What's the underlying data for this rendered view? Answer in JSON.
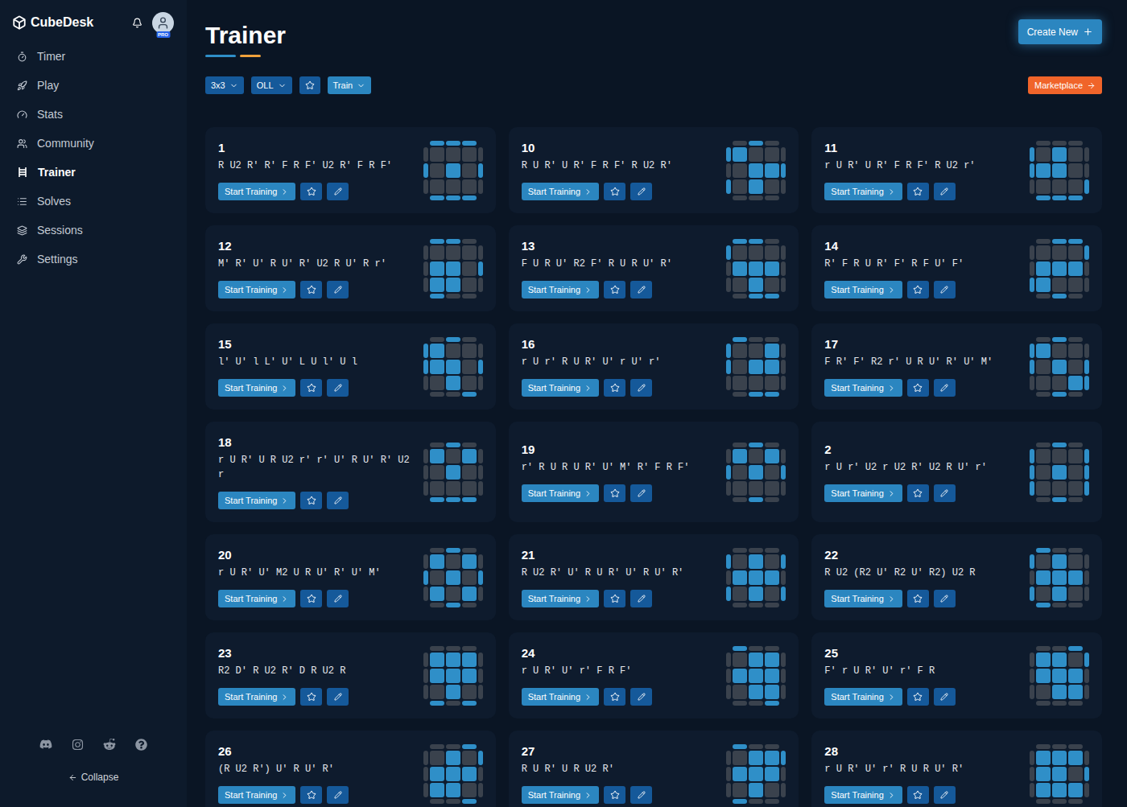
{
  "app": {
    "name": "CubeDesk",
    "badge": "PRO"
  },
  "sidebar": {
    "items": [
      {
        "label": "Timer",
        "selected": false
      },
      {
        "label": "Play",
        "selected": false
      },
      {
        "label": "Stats",
        "selected": false
      },
      {
        "label": "Community",
        "selected": false
      },
      {
        "label": "Trainer",
        "selected": true
      },
      {
        "label": "Solves",
        "selected": false
      },
      {
        "label": "Sessions",
        "selected": false
      },
      {
        "label": "Settings",
        "selected": false
      }
    ],
    "collapse": "Collapse"
  },
  "page": {
    "title": "Trainer"
  },
  "filters": [
    {
      "label": "3x3",
      "kind": "dropdown",
      "selected": false
    },
    {
      "label": "OLL",
      "kind": "dropdown",
      "selected": false
    },
    {
      "label": "",
      "kind": "favorite",
      "selected": false
    },
    {
      "label": "Train",
      "kind": "dropdown",
      "selected": true
    }
  ],
  "create_button": "Create New",
  "marketplace_button": "Marketplace",
  "card_action": "Start Training",
  "cards": [
    {
      "number": "1",
      "algorithm": "R U2 R' R' F R F' U2 R' F R F'",
      "favorite": false,
      "top": [
        false,
        false,
        false,
        false,
        true,
        false,
        false,
        false,
        false
      ],
      "sides": {
        "top": [
          true,
          true,
          true
        ],
        "right": [
          false,
          true,
          false
        ],
        "bottom": [
          true,
          true,
          true
        ],
        "left": [
          false,
          true,
          false
        ]
      }
    },
    {
      "number": "10",
      "algorithm": "R U R' U R' F R F' R U2 R'",
      "favorite": false,
      "top": [
        true,
        false,
        false,
        false,
        true,
        true,
        false,
        true,
        false
      ],
      "sides": {
        "top": [
          false,
          true,
          false
        ],
        "right": [
          false,
          true,
          false
        ],
        "bottom": [
          false,
          false,
          false
        ],
        "left": [
          true,
          false,
          true
        ]
      }
    },
    {
      "number": "11",
      "algorithm": "r U R' U R' F R F' R U2 r'",
      "favorite": false,
      "top": [
        false,
        true,
        false,
        true,
        true,
        false,
        false,
        false,
        false
      ],
      "sides": {
        "top": [
          false,
          false,
          false
        ],
        "right": [
          false,
          false,
          true
        ],
        "bottom": [
          true,
          true,
          true
        ],
        "left": [
          true,
          true,
          false
        ]
      }
    },
    {
      "number": "12",
      "algorithm": "M' R' U' R U' R' U2 R U' R r'",
      "favorite": false,
      "top": [
        false,
        false,
        false,
        true,
        true,
        false,
        true,
        true,
        false
      ],
      "sides": {
        "top": [
          true,
          true,
          false
        ],
        "right": [
          false,
          true,
          false
        ],
        "bottom": [
          true,
          false,
          false
        ],
        "left": [
          false,
          false,
          false
        ]
      }
    },
    {
      "number": "13",
      "algorithm": "F U R U' R2 F' R U R U' R'",
      "favorite": false,
      "top": [
        false,
        false,
        false,
        true,
        true,
        true,
        false,
        true,
        false
      ],
      "sides": {
        "top": [
          true,
          true,
          false
        ],
        "right": [
          false,
          false,
          false
        ],
        "bottom": [
          false,
          true,
          true
        ],
        "left": [
          true,
          false,
          false
        ]
      }
    },
    {
      "number": "14",
      "algorithm": "R' F R U R' F' R F U' F'",
      "favorite": false,
      "top": [
        false,
        false,
        false,
        true,
        true,
        true,
        true,
        false,
        false
      ],
      "sides": {
        "top": [
          false,
          true,
          true
        ],
        "right": [
          true,
          false,
          false
        ],
        "bottom": [
          false,
          true,
          false
        ],
        "left": [
          false,
          false,
          true
        ]
      }
    },
    {
      "number": "15",
      "algorithm": "l' U' l L' U' L U l' U l",
      "favorite": false,
      "top": [
        true,
        false,
        false,
        true,
        true,
        false,
        false,
        true,
        false
      ],
      "sides": {
        "top": [
          false,
          true,
          false
        ],
        "right": [
          false,
          true,
          false
        ],
        "bottom": [
          false,
          false,
          true
        ],
        "left": [
          true,
          true,
          false
        ]
      }
    },
    {
      "number": "16",
      "algorithm": "r U r' R U R' U' r U' r'",
      "favorite": false,
      "top": [
        false,
        false,
        true,
        false,
        true,
        true,
        false,
        false,
        false
      ],
      "sides": {
        "top": [
          true,
          false,
          false
        ],
        "right": [
          false,
          false,
          false
        ],
        "bottom": [
          false,
          true,
          true
        ],
        "left": [
          true,
          true,
          false
        ]
      }
    },
    {
      "number": "17",
      "algorithm": "F R' F' R2 r' U R U' R' U' M'",
      "favorite": false,
      "top": [
        true,
        false,
        false,
        false,
        true,
        false,
        false,
        false,
        true
      ],
      "sides": {
        "top": [
          false,
          true,
          false
        ],
        "right": [
          false,
          true,
          true
        ],
        "bottom": [
          false,
          true,
          false
        ],
        "left": [
          true,
          true,
          false
        ]
      }
    },
    {
      "number": "18",
      "algorithm": "r U R' U R U2 r' r' U' R U' R' U2 r",
      "favorite": false,
      "top": [
        true,
        false,
        true,
        false,
        true,
        false,
        false,
        false,
        false
      ],
      "sides": {
        "top": [
          false,
          true,
          false
        ],
        "right": [
          false,
          false,
          false
        ],
        "bottom": [
          true,
          true,
          true
        ],
        "left": [
          false,
          false,
          false
        ]
      }
    },
    {
      "number": "19",
      "algorithm": "r' R U R U R' U' M' R' F R F'",
      "favorite": false,
      "top": [
        true,
        false,
        true,
        false,
        true,
        false,
        false,
        false,
        false
      ],
      "sides": {
        "top": [
          false,
          true,
          false
        ],
        "right": [
          false,
          true,
          false
        ],
        "bottom": [
          false,
          true,
          false
        ],
        "left": [
          false,
          true,
          false
        ]
      }
    },
    {
      "number": "2",
      "algorithm": "r U r' U2 r U2 R' U2 R U' r'",
      "favorite": false,
      "top": [
        false,
        false,
        false,
        false,
        true,
        false,
        false,
        false,
        false
      ],
      "sides": {
        "top": [
          false,
          true,
          false
        ],
        "right": [
          true,
          true,
          true
        ],
        "bottom": [
          false,
          true,
          false
        ],
        "left": [
          true,
          true,
          true
        ]
      }
    },
    {
      "number": "20",
      "algorithm": "r U R' U' M2 U R U' R' U' M'",
      "favorite": false,
      "top": [
        true,
        false,
        true,
        false,
        true,
        false,
        true,
        false,
        true
      ],
      "sides": {
        "top": [
          false,
          true,
          false
        ],
        "right": [
          false,
          true,
          false
        ],
        "bottom": [
          false,
          true,
          false
        ],
        "left": [
          false,
          true,
          false
        ]
      }
    },
    {
      "number": "21",
      "algorithm": "R U2 R' U' R U R' U' R U' R'",
      "favorite": false,
      "top": [
        false,
        true,
        false,
        true,
        true,
        true,
        false,
        true,
        false
      ],
      "sides": {
        "top": [
          false,
          false,
          false
        ],
        "right": [
          true,
          false,
          true
        ],
        "bottom": [
          false,
          false,
          false
        ],
        "left": [
          true,
          false,
          true
        ]
      }
    },
    {
      "number": "22",
      "algorithm": "R U2 (R2 U' R2 U' R2) U2 R",
      "favorite": false,
      "top": [
        false,
        true,
        false,
        true,
        true,
        true,
        false,
        true,
        false
      ],
      "sides": {
        "top": [
          true,
          false,
          false
        ],
        "right": [
          false,
          false,
          false
        ],
        "bottom": [
          true,
          false,
          false
        ],
        "left": [
          true,
          false,
          true
        ]
      }
    },
    {
      "number": "23",
      "algorithm": "R2 D' R U2 R' D R U2 R",
      "favorite": false,
      "top": [
        true,
        true,
        true,
        true,
        true,
        true,
        false,
        true,
        false
      ],
      "sides": {
        "top": [
          false,
          false,
          false
        ],
        "right": [
          false,
          false,
          false
        ],
        "bottom": [
          true,
          false,
          true
        ],
        "left": [
          false,
          false,
          false
        ]
      }
    },
    {
      "number": "24",
      "algorithm": "r U R' U' r' F R F'",
      "favorite": false,
      "top": [
        false,
        true,
        true,
        true,
        true,
        true,
        false,
        true,
        true
      ],
      "sides": {
        "top": [
          true,
          false,
          false
        ],
        "right": [
          false,
          false,
          false
        ],
        "bottom": [
          false,
          false,
          true
        ],
        "left": [
          false,
          false,
          false
        ]
      }
    },
    {
      "number": "25",
      "algorithm": "F' r U R' U' r' F R",
      "favorite": false,
      "top": [
        true,
        true,
        false,
        true,
        true,
        true,
        false,
        true,
        true
      ],
      "sides": {
        "top": [
          false,
          false,
          true
        ],
        "right": [
          true,
          false,
          false
        ],
        "bottom": [
          false,
          false,
          false
        ],
        "left": [
          false,
          false,
          false
        ]
      }
    },
    {
      "number": "26",
      "algorithm": "(R U2 R') U' R U' R'",
      "favorite": false,
      "top": [
        false,
        true,
        false,
        true,
        true,
        true,
        true,
        true,
        false
      ],
      "sides": {
        "top": [
          false,
          false,
          true
        ],
        "right": [
          true,
          false,
          false
        ],
        "bottom": [
          false,
          false,
          true
        ],
        "left": [
          false,
          false,
          false
        ]
      }
    },
    {
      "number": "27",
      "algorithm": "R U R' U R U2 R'",
      "favorite": false,
      "top": [
        false,
        true,
        true,
        true,
        true,
        true,
        false,
        true,
        false
      ],
      "sides": {
        "top": [
          true,
          false,
          false
        ],
        "right": [
          true,
          false,
          false
        ],
        "bottom": [
          true,
          false,
          false
        ],
        "left": [
          false,
          false,
          false
        ]
      }
    },
    {
      "number": "28",
      "algorithm": "r U R' U' r' R U R U' R'",
      "favorite": false,
      "top": [
        true,
        true,
        true,
        true,
        true,
        false,
        true,
        true,
        true
      ],
      "sides": {
        "top": [
          false,
          false,
          false
        ],
        "right": [
          false,
          true,
          false
        ],
        "bottom": [
          false,
          false,
          false
        ],
        "left": [
          false,
          false,
          false
        ]
      }
    }
  ]
}
